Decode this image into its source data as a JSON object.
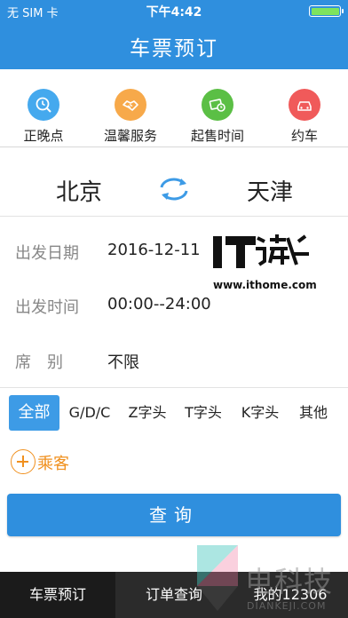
{
  "status_bar": {
    "carrier": "无 SIM 卡",
    "time": "下午4:42"
  },
  "header": {
    "title": "车票预订"
  },
  "quick_actions": [
    {
      "label": "正晚点",
      "icon": "clock-search-icon",
      "color": "#45a9ee"
    },
    {
      "label": "温馨服务",
      "icon": "handshake-icon",
      "color": "#f7a94a"
    },
    {
      "label": "起售时间",
      "icon": "ticket-clock-icon",
      "color": "#5bbf45"
    },
    {
      "label": "约车",
      "icon": "car-icon",
      "color": "#f05a5a"
    }
  ],
  "route": {
    "from": "北京",
    "to": "天津"
  },
  "form": {
    "date_label": "出发日期",
    "date_value": "2016-12-11",
    "time_label": "出发时间",
    "time_value": "00:00--24:00",
    "seat_label": "席别",
    "seat_value": "不限"
  },
  "train_types": [
    "全部",
    "G/D/C",
    "Z字头",
    "T字头",
    "K字头",
    "其他"
  ],
  "selected_train_type": "全部",
  "passenger_label": "乘客",
  "query_button": "查询",
  "watermark": {
    "logo": "IT之家",
    "url": "www.ithome.com"
  },
  "tabs": [
    "车票预订",
    "订单查询",
    "我的12306"
  ],
  "active_tab": "车票预订",
  "brand_watermark": {
    "title": "电科技",
    "subtitle": "DIANKEJI.COM"
  },
  "colors": {
    "primary": "#2f8fde",
    "accent_orange": "#f0901e",
    "tabbar": "#2b2b2b"
  }
}
